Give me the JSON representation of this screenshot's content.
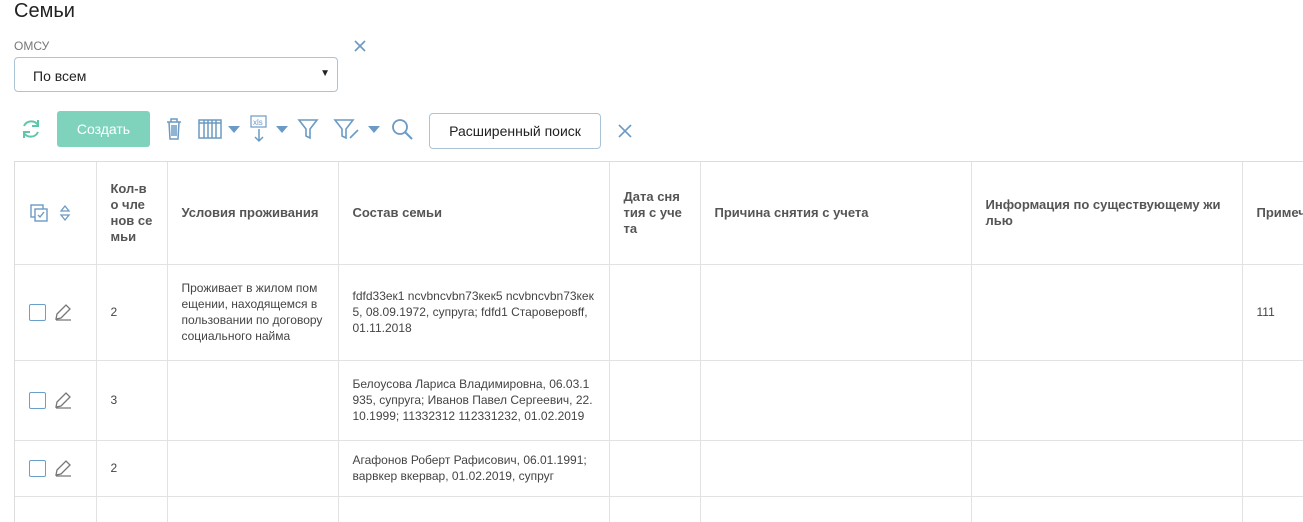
{
  "page": {
    "title": "Семьи"
  },
  "filter": {
    "label": "ОМСУ",
    "value": "По всем"
  },
  "toolbar": {
    "create_label": "Создать",
    "advanced_search_label": "Расширенный поиск",
    "icons": [
      "refresh-icon",
      "trash-icon",
      "columns-icon",
      "xls-export-icon",
      "filter-icon",
      "filter-edit-icon",
      "search-icon",
      "close-icon"
    ]
  },
  "table": {
    "columns": [
      "",
      "Кол-во членов семьи",
      "Условия проживания",
      "Состав семьи",
      "Дата снятия с учета",
      "Причина снятия с учета",
      "Информация по существующему жилью",
      "Примечание"
    ],
    "rows": [
      {
        "count": "2",
        "conditions": "Проживает в жилом помещении, находящемся в пользовании по договору социального найма",
        "composition": "fdfd33ек1 ncvbncvbn73кек5 ncvbncvbn73кек5, 08.09.1972, супруга; fdfd1 Староверовff, 01.11.2018",
        "removal_date": "",
        "removal_reason": "",
        "housing_info": "",
        "note": "111"
      },
      {
        "count": "3",
        "conditions": "",
        "composition": "Белоусова Лариса Владимировна, 06.03.1935, супруга; Иванов Павел Сергеевич, 22.10.1999; 11332312 112331232, 01.02.2019",
        "removal_date": "",
        "removal_reason": "",
        "housing_info": "",
        "note": ""
      },
      {
        "count": "2",
        "conditions": "",
        "composition": "Агафонов Роберт Рафисович, 06.01.1991; варвкер вкервар, 01.02.2019, супруг",
        "removal_date": "",
        "removal_reason": "",
        "housing_info": "",
        "note": ""
      }
    ]
  },
  "colors": {
    "accent": "#7fd3bd",
    "icon": "#6b9ac4",
    "icon_green": "#5fc7a9"
  }
}
